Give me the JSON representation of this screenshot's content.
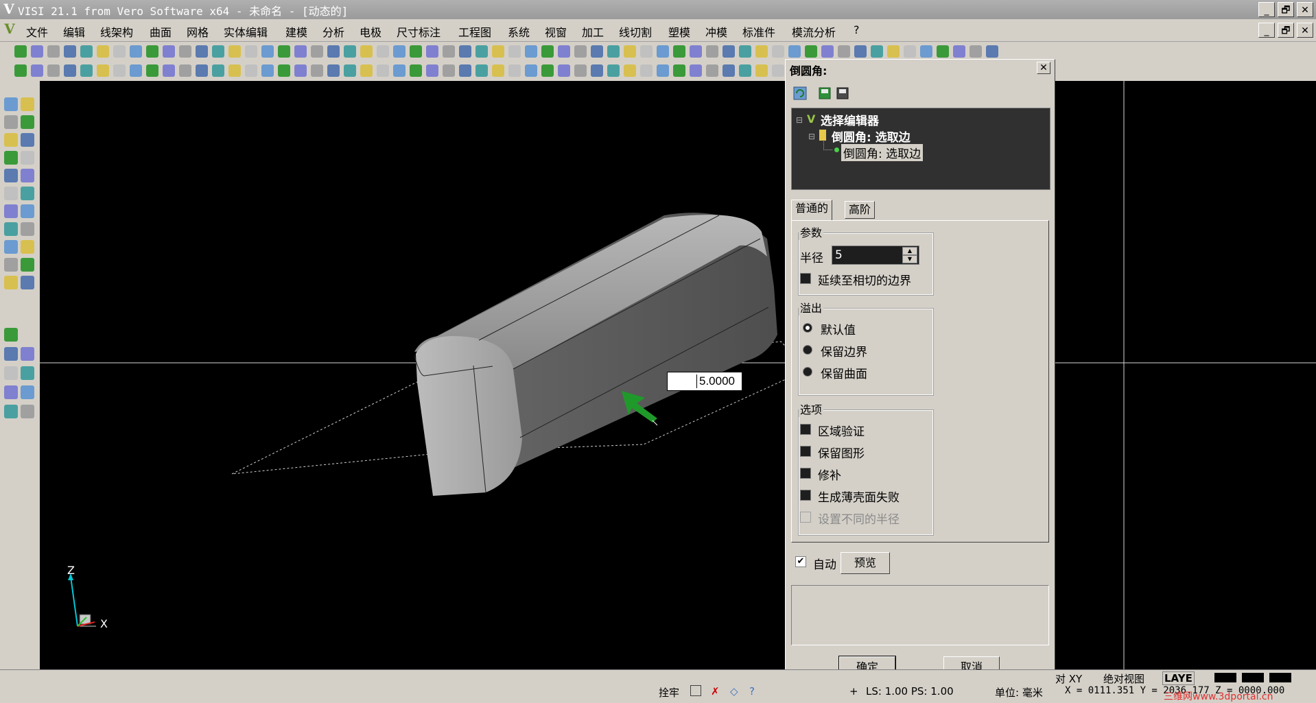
{
  "window": {
    "title": "VISI 21.1 from Vero Software x64 - 未命名 - [动态的]",
    "buttons": {
      "minimize": "_",
      "restore": "🗗",
      "close": "✕"
    }
  },
  "menu": {
    "items": [
      "文件",
      "编辑",
      "线架构",
      "曲面",
      "网格",
      "实体编辑",
      "建模",
      "分析",
      "电极",
      "尺寸标注",
      "工程图",
      "系统",
      "视窗",
      "加工",
      "线切割",
      "塑模",
      "冲模",
      "标准件",
      "模流分析",
      "?"
    ]
  },
  "viewport": {
    "dimension_value": "5.0000",
    "axis": {
      "z": "Z",
      "x": "X"
    },
    "colors": {
      "background": "#000000",
      "solid": "#8e8e8e",
      "arrow": "#1f9a2a"
    }
  },
  "dialog": {
    "title": "倒圆角:",
    "close": "✕",
    "tree": {
      "root": "选择编辑器",
      "child": "倒圆角: 选取边",
      "leaf": "倒圆角: 选取边"
    },
    "tabs": [
      "普通的",
      "高阶"
    ],
    "params": {
      "group_label": "参数",
      "radius_label": "半径",
      "radius_value": "5",
      "extend_label": "延续至相切的边界"
    },
    "overflow": {
      "group_label": "溢出",
      "options": [
        "默认值",
        "保留边界",
        "保留曲面"
      ],
      "selected": "默认值"
    },
    "options": {
      "group_label": "选项",
      "items": [
        "区域验证",
        "保留图形",
        "修补",
        "生成薄壳面失败",
        "设置不同的半径"
      ]
    },
    "auto_label": "自动",
    "preview_label": "预览",
    "ok_label": "确定",
    "cancel_label": "取消"
  },
  "status": {
    "lock_label": "拴牢",
    "ls_ps": "LS: 1.00 PS: 1.00",
    "unit": "单位: 毫米",
    "coords": "X = 0111.351 Y = 2036.177 Z = 0000.000",
    "rel_xy": "对 XY",
    "abs_view": "绝对视图",
    "layer": "LAYE",
    "watermark": "三维网www.3dportal.cn"
  }
}
